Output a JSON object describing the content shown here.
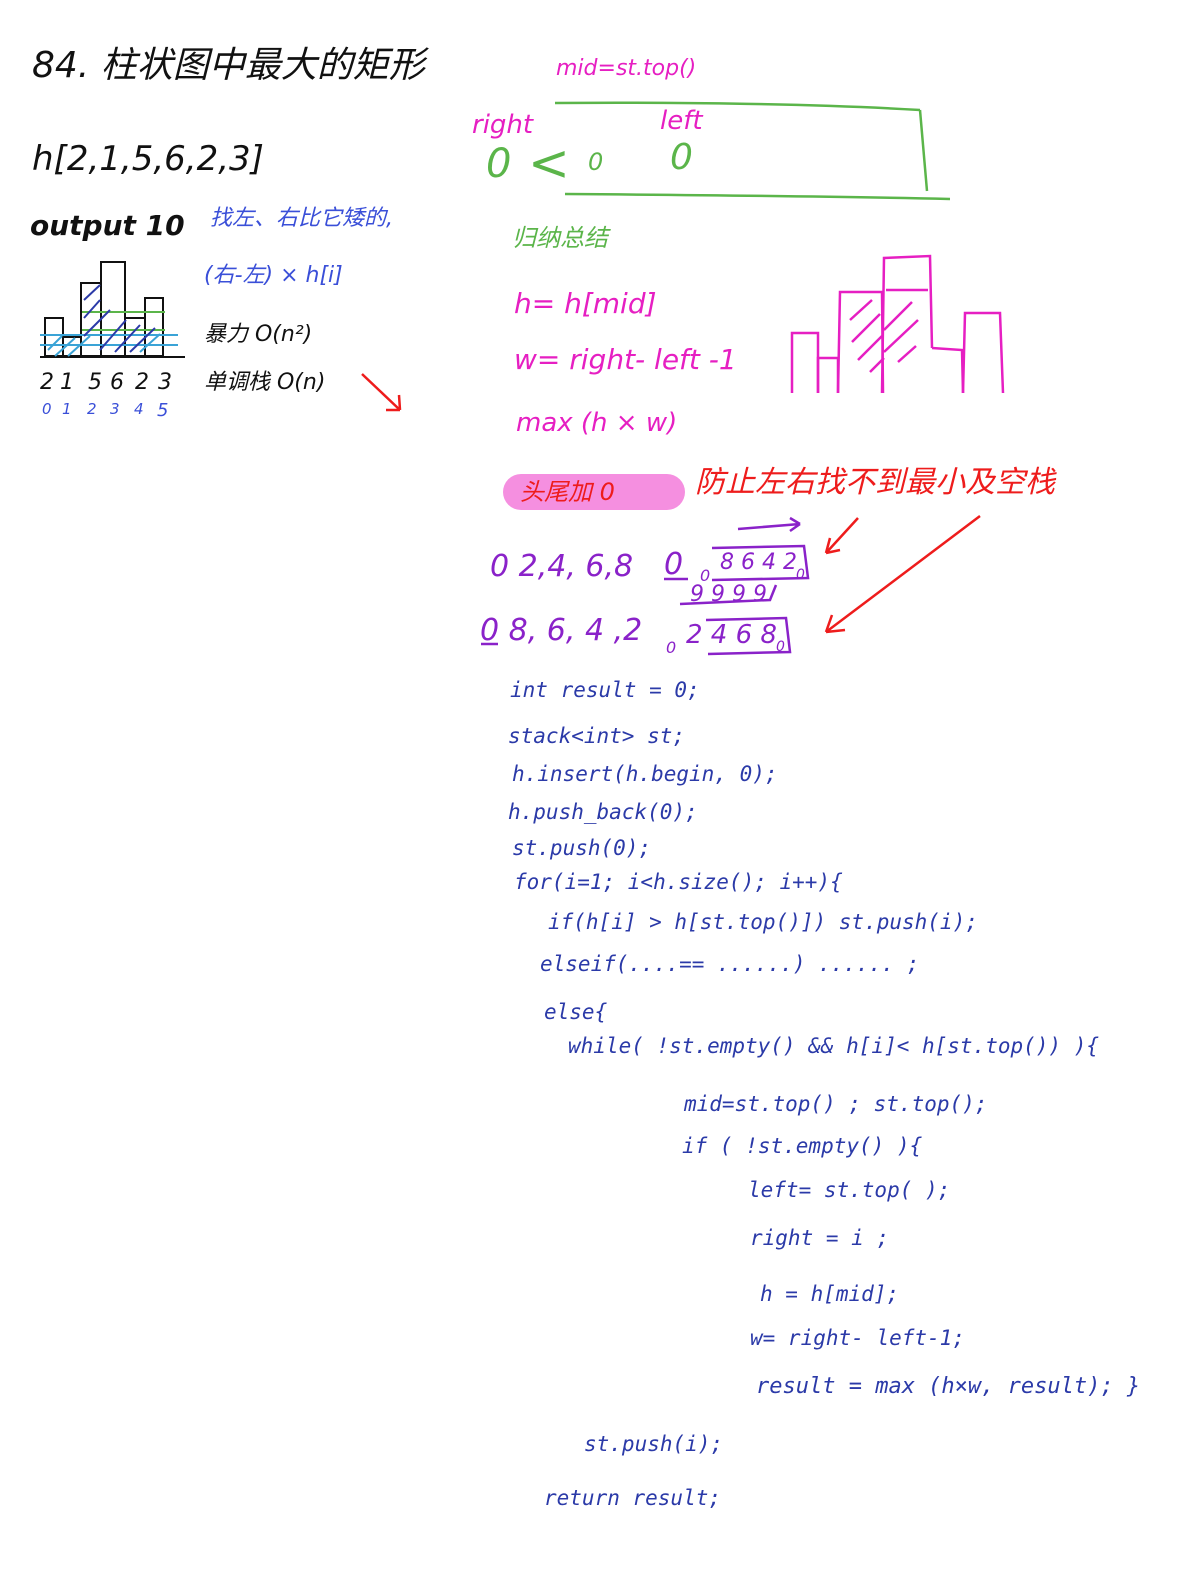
{
  "title": "84. 柱状图中最大的矩形",
  "input_array": "h[2,1,5,6,2,3]",
  "output": "output 10",
  "left_notes": {
    "find_left_right": "找左、右比它矮的,",
    "formula": "(右-左) × h[i]",
    "brute_force": "暴力 O(n²)",
    "mono_stack": "单调栈 O(n)"
  },
  "histogram_values": [
    "2",
    "1",
    "5",
    "6",
    "2",
    "3"
  ],
  "histogram_indices": [
    "0",
    "1",
    "2",
    "3",
    "4",
    "5"
  ],
  "stack_diagram": {
    "mid_label": "mid=st.top()",
    "right_label": "right",
    "left_label": "left",
    "right_zero": "0",
    "lt_sign": "<",
    "inner_zero_1": "0",
    "inner_zero_2": "0"
  },
  "summary_title": "归纳总结",
  "formulas": {
    "h": "h= h[mid]",
    "w": "w= right- left -1",
    "max": "max (h × w)"
  },
  "pad_note": {
    "pill": "头尾加 0",
    "explain": "防止左右找不到最小及空栈"
  },
  "examples": {
    "row1": {
      "seq": "0 2,4, 6,8",
      "zero": "0",
      "stack_prefix": "0",
      "stack_values": "8 6 4 2",
      "stack_suffix": "0"
    },
    "strike_row": "9 9 9 9",
    "row2": {
      "seq": "0 8, 6, 4 ,2",
      "stack_prefix": "0",
      "stack_values": "2 4 6 8",
      "stack_suffix": "0"
    }
  },
  "code": [
    "int  result = 0;",
    "stack<int>   st;",
    "h.insert(h.begin, 0);",
    "h.push_back(0);",
    "st.push(0);",
    "for(i=1; i<h.size(); i++){",
    "if(h[i] > h[st.top()])  st.push(i);",
    "elseif(....==     ......)      ......   ;",
    "else{",
    "while( !st.empty() && h[i]< h[st.top()) ){",
    "mid=st.top() ; st.top();",
    "if ( !st.empty() ){",
    "left= st.top( );",
    "right = i ;",
    "h = h[mid];",
    "w= right- left-1;",
    "result = max (h×w,  result); }",
    "st.push(i);",
    "return   result;"
  ]
}
